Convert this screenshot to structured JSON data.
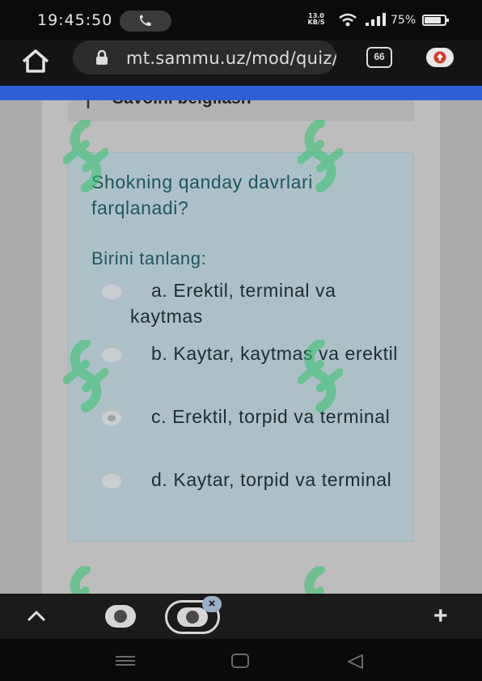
{
  "status_bar": {
    "time": "19:45:50",
    "net_speed_value": "13.0",
    "net_speed_unit": "KB/S",
    "battery": "75%"
  },
  "browser": {
    "url": "mt.sammu.uz/mod/quiz/attempt.php",
    "tab_count": "66"
  },
  "page": {
    "flag_label": "Savolni belgilash",
    "question": "Shokning qanday davrlari farqlanadi?",
    "prompt": "Birini tanlang:",
    "options": [
      {
        "label": "a. Erektil, terminal va kaytmas",
        "checked": false
      },
      {
        "label": "b. Kaytar, kaytmas va erektil",
        "checked": false
      },
      {
        "label": "c. Erektil, torpid va terminal",
        "checked": true
      },
      {
        "label": "d. Kaytar, torpid va terminal",
        "checked": false
      }
    ]
  },
  "bottom_bar": {
    "close_label": "×",
    "plus_label": "+"
  },
  "colors": {
    "accent": "#2f5fd6",
    "question_text": "#1f5560",
    "card_bg": "#aec0c7",
    "watermark": "#2fc46a"
  },
  "icons": [
    "home-icon",
    "lock-icon",
    "tabs-icon",
    "update-icon",
    "chevron-up-icon",
    "plus-icon",
    "flag-icon",
    "radio-icon"
  ]
}
